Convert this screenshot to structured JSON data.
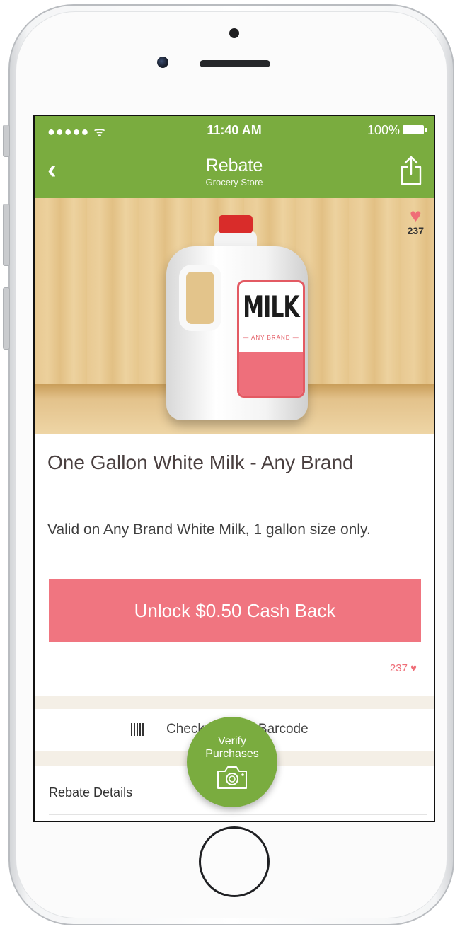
{
  "status_bar": {
    "signal": "●●●●● ᯤ",
    "time": "11:40 AM",
    "battery": "100%"
  },
  "nav": {
    "back_glyph": "‹",
    "title": "Rebate",
    "subtitle": "Grocery Store"
  },
  "hero": {
    "heart_count": "237",
    "label_word": "MILK",
    "label_brand": "— ANY BRAND —"
  },
  "product": {
    "title": "One Gallon White Milk - Any Brand",
    "description": "Valid on Any Brand White Milk, 1 gallon size only.",
    "unlock_label": "Unlock $0.50 Cash Back",
    "likes": "237"
  },
  "barcode": {
    "label": "Check Product Barcode"
  },
  "details": {
    "label": "Rebate Details"
  },
  "verify": {
    "line1": "Verify",
    "line2": "Purchases"
  },
  "colors": {
    "brand_green": "#7aac3f",
    "accent_pink": "#f07580",
    "heart": "#ef6d77"
  },
  "icons": [
    "back-chevron-icon",
    "share-icon",
    "heart-icon",
    "barcode-icon",
    "camera-icon"
  ]
}
